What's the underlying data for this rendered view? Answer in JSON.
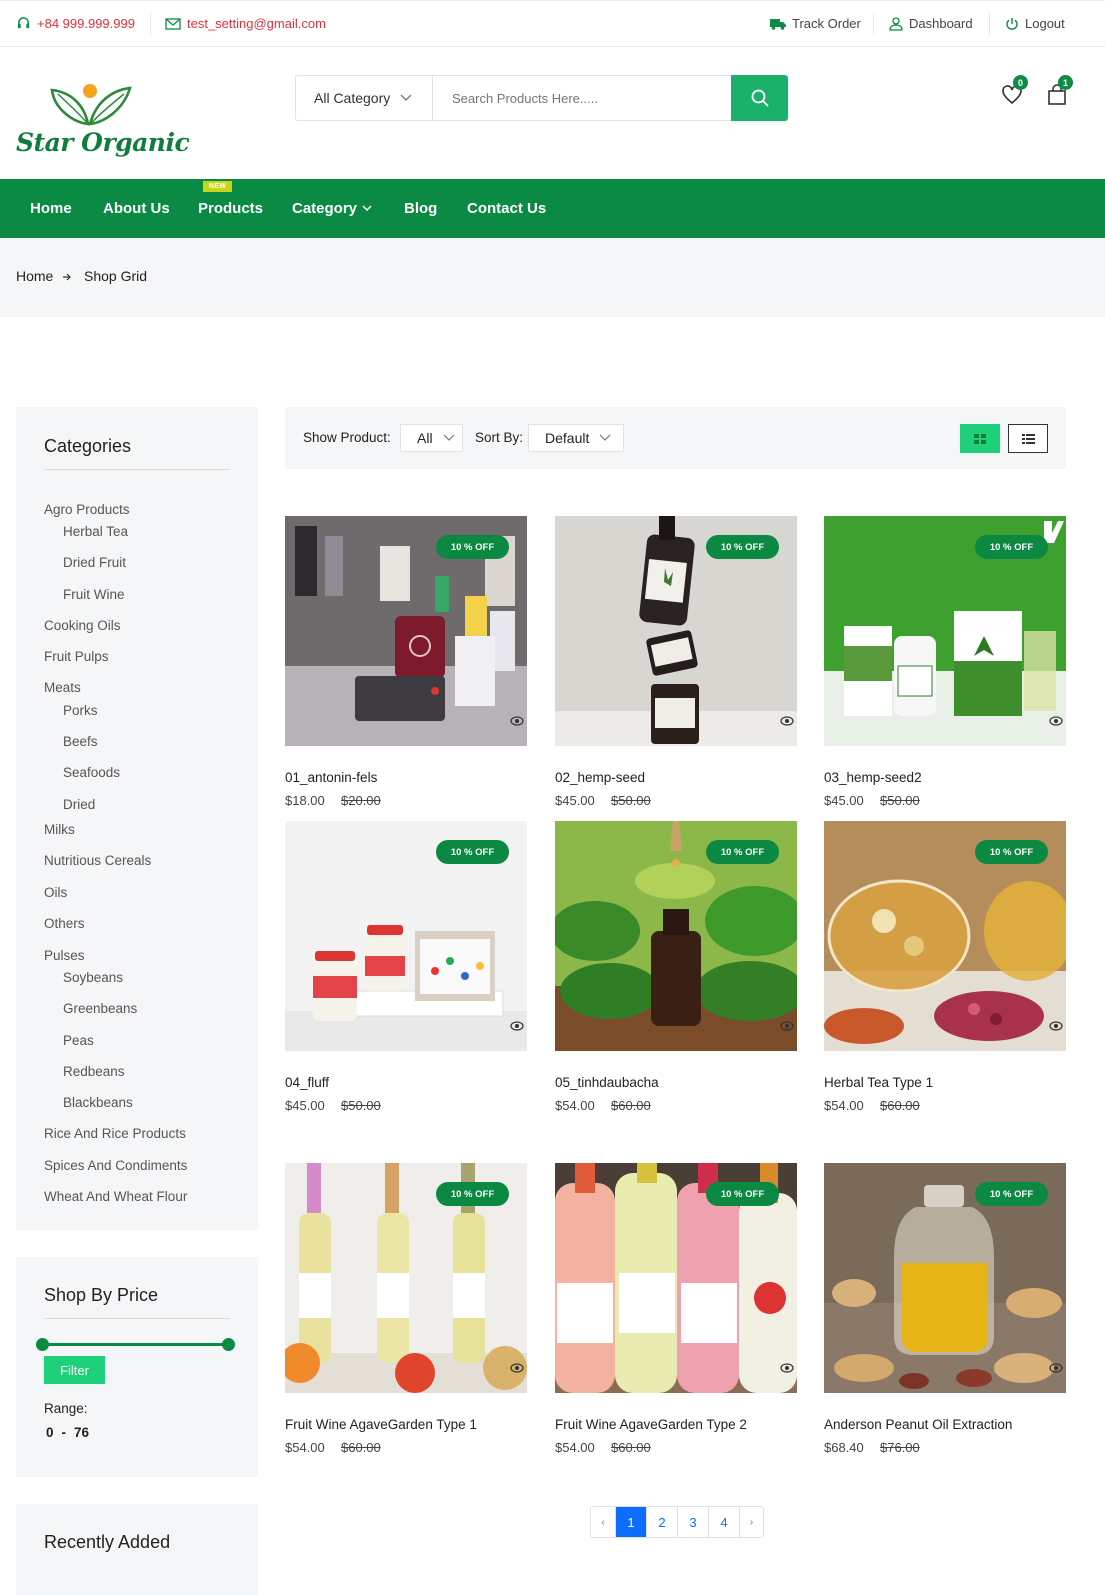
{
  "topbar": {
    "phone": "+84 999.999.999",
    "email": "test_setting@gmail.com",
    "track_order": "Track Order",
    "dashboard": "Dashboard",
    "logout": "Logout"
  },
  "header": {
    "logo_text": "Star Organic",
    "category_select": "All Category",
    "search_placeholder": "Search Products Here.....",
    "wishlist_count": "0",
    "cart_count": "1"
  },
  "nav": {
    "items": [
      "Home",
      "About Us",
      "Products",
      "Category",
      "Blog",
      "Contact Us"
    ],
    "new_badge": "NEW"
  },
  "breadcrumb": {
    "home": "Home",
    "current": "Shop Grid"
  },
  "sidebar": {
    "categories_title": "Categories",
    "categories": [
      {
        "label": "Agro Products",
        "level": 0
      },
      {
        "label": "Herbal Tea",
        "level": 1
      },
      {
        "label": "Dried Fruit",
        "level": 1
      },
      {
        "label": "Fruit Wine",
        "level": 1
      },
      {
        "label": "Cooking Oils",
        "level": 0
      },
      {
        "label": "Fruit Pulps",
        "level": 0
      },
      {
        "label": "Meats",
        "level": 0
      },
      {
        "label": "Porks",
        "level": 1
      },
      {
        "label": "Beefs",
        "level": 1
      },
      {
        "label": "Seafoods",
        "level": 1
      },
      {
        "label": "Dried",
        "level": 1
      },
      {
        "label": "Milks",
        "level": 0
      },
      {
        "label": "Nutritious Cereals",
        "level": 0
      },
      {
        "label": "Oils",
        "level": 0
      },
      {
        "label": "Others",
        "level": 0
      },
      {
        "label": "Pulses",
        "level": 0
      },
      {
        "label": "Soybeans",
        "level": 1
      },
      {
        "label": "Greenbeans",
        "level": 1
      },
      {
        "label": "Peas",
        "level": 1
      },
      {
        "label": "Redbeans",
        "level": 1
      },
      {
        "label": "Blackbeans",
        "level": 1
      },
      {
        "label": "Rice And Rice Products",
        "level": 0
      },
      {
        "label": "Spices And Condiments",
        "level": 0
      },
      {
        "label": "Wheat And Wheat Flour",
        "level": 0
      }
    ],
    "price_title": "Shop By Price",
    "filter_button": "Filter",
    "range_label": "Range:",
    "range_min": "0",
    "range_sep": "-",
    "range_max": "76",
    "recent_title": "Recently Added"
  },
  "toolbar": {
    "show_label": "Show Product:",
    "show_value": "All",
    "sort_label": "Sort By:",
    "sort_value": "Default"
  },
  "colors": {
    "brand_green": "#0a8a42",
    "accent_green": "#1ab26b",
    "link_blue": "#0d6efd",
    "phone_red": "#e0303d"
  },
  "products": [
    {
      "name": "01_antonin-fels",
      "price": "$18.00",
      "old_price": "$20.00",
      "discount": "10 % OFF",
      "image": "vape-bottles"
    },
    {
      "name": "02_hemp-seed",
      "price": "$45.00",
      "old_price": "$50.00",
      "discount": "10 % OFF",
      "image": "hemp-bottles"
    },
    {
      "name": "03_hemp-seed2",
      "price": "$45.00",
      "old_price": "$50.00",
      "discount": "10 % OFF",
      "image": "hemp-boxes"
    },
    {
      "name": "04_fluff",
      "price": "$45.00",
      "old_price": "$50.00",
      "discount": "10 % OFF",
      "image": "fluff-jars"
    },
    {
      "name": "05_tinhdaubacha",
      "price": "$54.00",
      "old_price": "$60.00",
      "discount": "10 % OFF",
      "image": "mint-oil"
    },
    {
      "name": "Herbal Tea Type 1",
      "price": "$54.00",
      "old_price": "$60.00",
      "discount": "10 % OFF",
      "image": "herbal-tea"
    },
    {
      "name": "Fruit Wine AgaveGarden Type 1",
      "price": "$54.00",
      "old_price": "$60.00",
      "discount": "10 % OFF",
      "image": "white-wine"
    },
    {
      "name": "Fruit Wine AgaveGarden Type 2",
      "price": "$54.00",
      "old_price": "$60.00",
      "discount": "10 % OFF",
      "image": "fruit-wine"
    },
    {
      "name": "Anderson Peanut Oil Extraction",
      "price": "$68.40",
      "old_price": "$76.00",
      "discount": "10 % OFF",
      "image": "peanut-oil"
    }
  ],
  "pagination": {
    "prev": "‹",
    "pages": [
      "1",
      "2",
      "3",
      "4"
    ],
    "next": "›",
    "current": "1"
  }
}
